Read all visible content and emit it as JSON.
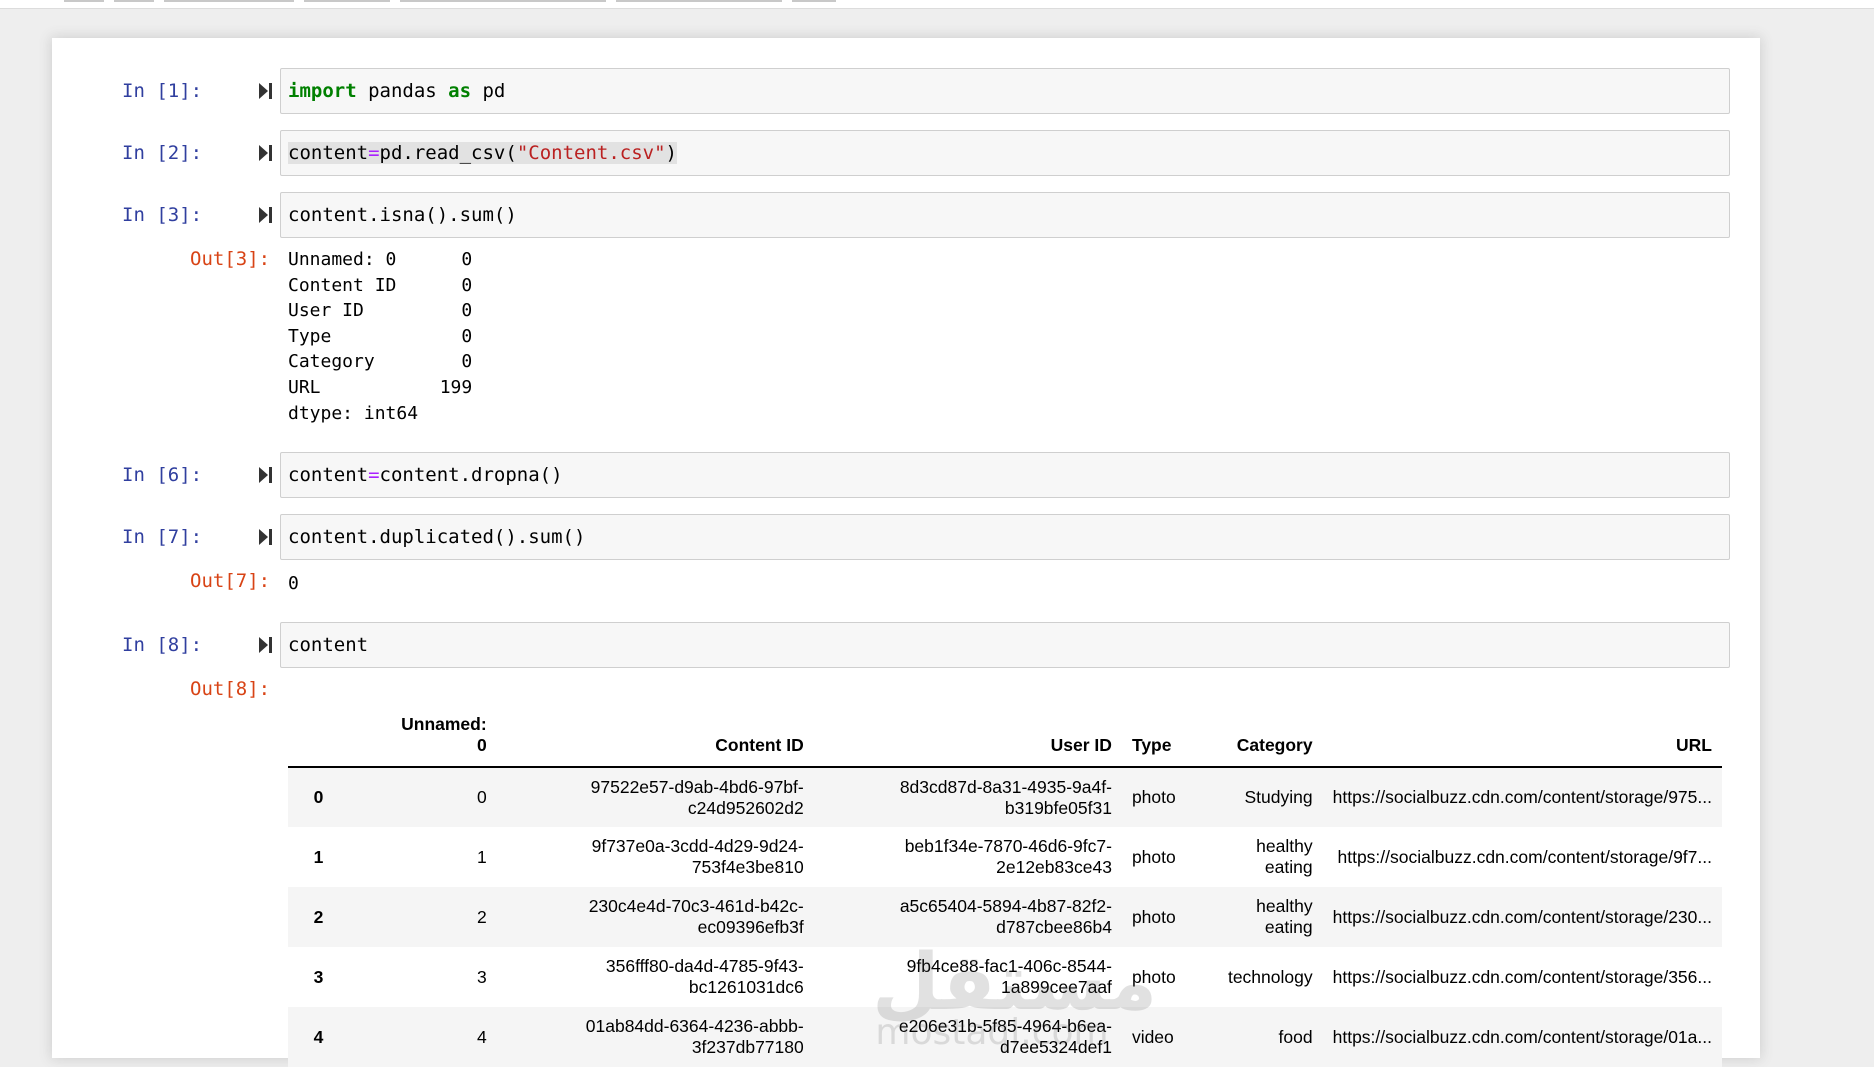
{
  "cells": [
    {
      "in_prompt": "In [1]:",
      "code_parts": [
        {
          "t": "import",
          "c": "kw"
        },
        {
          "t": " pandas ",
          "c": ""
        },
        {
          "t": "as",
          "c": "kw"
        },
        {
          "t": " pd",
          "c": ""
        }
      ]
    },
    {
      "in_prompt": "In [2]:",
      "code_parts": [
        {
          "t": "content",
          "c": "hl"
        },
        {
          "t": "=",
          "c": "hl op"
        },
        {
          "t": "pd.read_csv(",
          "c": "hl"
        },
        {
          "t": "\"Content.csv\"",
          "c": "hl str"
        },
        {
          "t": ")",
          "c": "hl"
        }
      ]
    },
    {
      "in_prompt": "In [3]:",
      "code_parts": [
        {
          "t": "content.isna().sum()",
          "c": ""
        }
      ],
      "out_prompt": "Out[3]:",
      "output": "Unnamed: 0      0\nContent ID      0\nUser ID         0\nType            0\nCategory        0\nURL           199\ndtype: int64"
    },
    {
      "in_prompt": "In [6]:",
      "code_parts": [
        {
          "t": "content",
          "c": ""
        },
        {
          "t": "=",
          "c": "op"
        },
        {
          "t": "content.dropna()",
          "c": ""
        }
      ]
    },
    {
      "in_prompt": "In [7]:",
      "code_parts": [
        {
          "t": "content.duplicated().sum()",
          "c": ""
        }
      ],
      "out_prompt": "Out[7]:",
      "output": "0"
    },
    {
      "in_prompt": "In [8]:",
      "code_parts": [
        {
          "t": "content",
          "c": ""
        }
      ],
      "out_prompt": "Out[8]:"
    }
  ],
  "dataframe": {
    "columns": [
      "",
      "Unnamed:\n0",
      "Content ID",
      "User ID",
      "Type",
      "Category",
      "URL"
    ],
    "rows": [
      [
        "0",
        "0",
        "97522e57-d9ab-4bd6-97bf-\nc24d952602d2",
        "8d3cd87d-8a31-4935-9a4f-\nb319bfe05f31",
        "photo",
        "Studying",
        "https://socialbuzz.cdn.com/content/storage/975..."
      ],
      [
        "1",
        "1",
        "9f737e0a-3cdd-4d29-9d24-\n753f4e3be810",
        "beb1f34e-7870-46d6-9fc7-\n2e12eb83ce43",
        "photo",
        "healthy\neating",
        "https://socialbuzz.cdn.com/content/storage/9f7..."
      ],
      [
        "2",
        "2",
        "230c4e4d-70c3-461d-b42c-\nec09396efb3f",
        "a5c65404-5894-4b87-82f2-\nd787cbee86b4",
        "photo",
        "healthy\neating",
        "https://socialbuzz.cdn.com/content/storage/230..."
      ],
      [
        "3",
        "3",
        "356fff80-da4d-4785-9f43-\nbc1261031dc6",
        "9fb4ce88-fac1-406c-8544-\n1a899cee7aaf",
        "photo",
        "technology",
        "https://socialbuzz.cdn.com/content/storage/356..."
      ],
      [
        "4",
        "4",
        "01ab84dd-6364-4236-abbb-\n3f237db77180",
        "e206e31b-5f85-4964-b6ea-\nd7ee5324def1",
        "video",
        "food",
        "https://socialbuzz.cdn.com/content/storage/01a..."
      ]
    ]
  },
  "watermark": {
    "big": "مستقل",
    "small": "mostaql.com"
  }
}
